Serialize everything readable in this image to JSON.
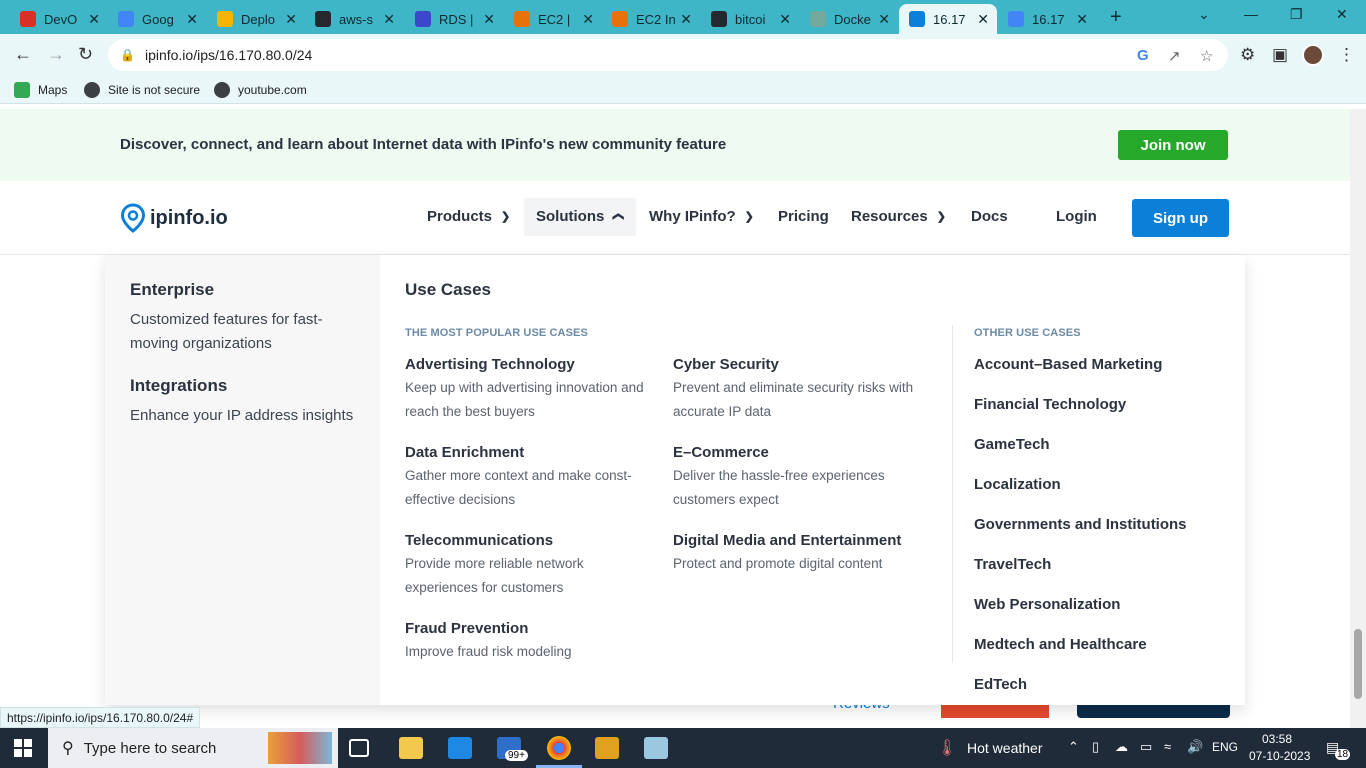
{
  "tabs": [
    {
      "title": "DevO",
      "icon": "gmail-icon",
      "color": "#d93025"
    },
    {
      "title": "Goog",
      "icon": "google-translate-icon",
      "color": "#4285f4"
    },
    {
      "title": "Deplo",
      "icon": "box-icon",
      "color": "#f4b400"
    },
    {
      "title": "aws-s",
      "icon": "github-icon",
      "color": "#24292f"
    },
    {
      "title": "RDS |",
      "icon": "rds-icon",
      "color": "#3b48cc"
    },
    {
      "title": "EC2 |",
      "icon": "ec2-icon",
      "color": "#e8710a"
    },
    {
      "title": "EC2 In",
      "icon": "aws-cube-icon",
      "color": "#e8710a"
    },
    {
      "title": "bitcoi",
      "icon": "github-icon",
      "color": "#24292f"
    },
    {
      "title": "Docke",
      "icon": "chatgpt-icon",
      "color": "#74aa9c"
    },
    {
      "title": "16.17",
      "icon": "ipinfo-icon",
      "color": "#0c7fd9"
    },
    {
      "title": "16.17",
      "icon": "google-icon",
      "color": "#4285f4"
    }
  ],
  "url": "ipinfo.io/ips/16.170.80.0/24",
  "bookmarks": [
    "Maps",
    "Site is not secure",
    "youtube.com"
  ],
  "banner": {
    "text": "Discover, connect, and learn about Internet data with IPinfo's new community feature",
    "button": "Join now"
  },
  "nav": {
    "logo": "ipinfo.io",
    "products": "Products",
    "solutions": "Solutions",
    "why": "Why IPinfo?",
    "pricing": "Pricing",
    "resources": "Resources",
    "docs": "Docs",
    "login": "Login",
    "signup": "Sign up"
  },
  "mega": {
    "left": [
      {
        "title": "Enterprise",
        "desc": "Customized features for fast-moving organizations"
      },
      {
        "title": "Integrations",
        "desc": "Enhance your IP address insights"
      }
    ],
    "use_cases_title": "Use Cases",
    "popular_label": "THE MOST POPULAR USE CASES",
    "popular": [
      {
        "title": "Advertising Technology",
        "desc": "Keep up with advertising innovation and reach the best buyers"
      },
      {
        "title": "Cyber Security",
        "desc": "Prevent and eliminate security risks with accurate IP data"
      },
      {
        "title": "Data Enrichment",
        "desc": "Gather more context and make const-effective decisions"
      },
      {
        "title": "E–Commerce",
        "desc": "Deliver the hassle-free experiences customers expect"
      },
      {
        "title": "Telecommunications",
        "desc": "Provide more reliable network experiences for customers"
      },
      {
        "title": "Digital Media and Entertainment",
        "desc": "Protect and promote digital content"
      },
      {
        "title": "Fraud Prevention",
        "desc": "Improve fraud risk modeling"
      }
    ],
    "other_label": "OTHER USE CASES",
    "other": [
      "Account–Based Marketing",
      "Financial Technology",
      "GameTech",
      "Localization",
      "Governments and Institutions",
      "TravelTech",
      "Web Personalization",
      "Medtech and Healthcare",
      "EdTech"
    ]
  },
  "below": {
    "reviews": "Reviews"
  },
  "status_url": "https://ipinfo.io/ips/16.170.80.0/24#",
  "taskbar": {
    "search_placeholder": "Type here to search",
    "weather": "Hot weather",
    "lang": "ENG",
    "time": "03:58",
    "date": "07-10-2023",
    "mail_badge": "99+",
    "notif_count": "18"
  }
}
